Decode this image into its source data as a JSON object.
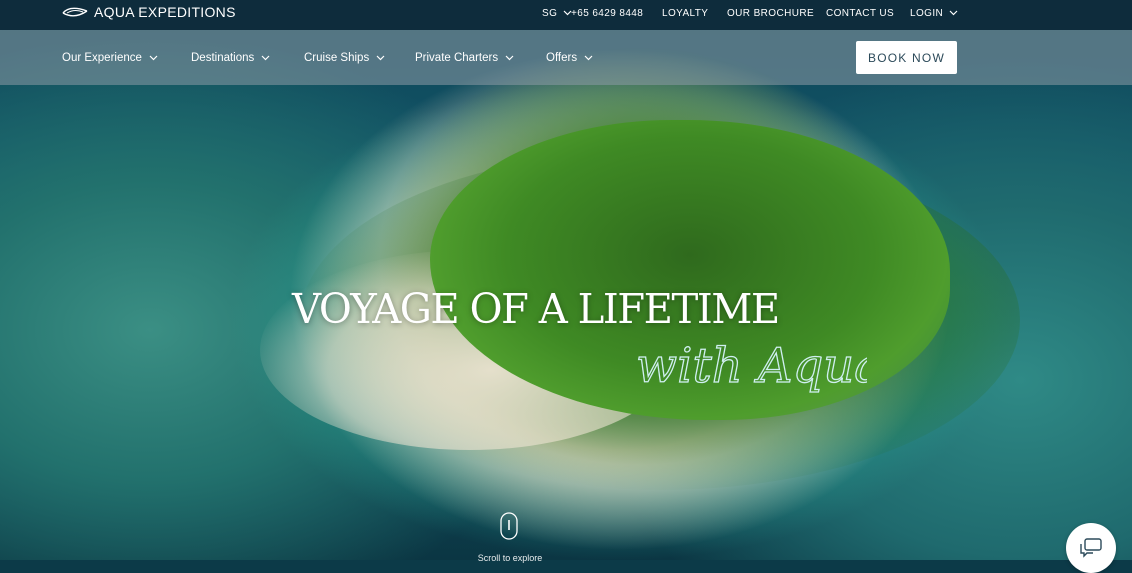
{
  "brand": {
    "name": "AQUA EXPEDITIONS",
    "logo_icon": "wave-logo-icon"
  },
  "utility_nav": {
    "region": "SG",
    "phone": "+65 6429 8448",
    "loyalty": "LOYALTY",
    "brochure": "OUR BROCHURE",
    "contact": "CONTACT US",
    "login": "LOGIN"
  },
  "main_nav": {
    "items": [
      {
        "label": "Our Experience"
      },
      {
        "label": "Destinations"
      },
      {
        "label": "Cruise Ships"
      },
      {
        "label": "Private Charters"
      },
      {
        "label": "Offers"
      }
    ],
    "book_label": "BOOK NOW"
  },
  "hero": {
    "headline": "VOYAGE OF A LIFETIME",
    "script_text": "with Aqua",
    "scroll_text": "Scroll to explore"
  },
  "icons": {
    "chevron": "chevron-down-icon",
    "scroll": "mouse-scroll-icon",
    "chat": "chat-bubble-icon"
  },
  "colors": {
    "topbar": "#0e2a3a",
    "button_text": "#2c4a5a",
    "sea": "#12566a",
    "lagoon": "#3fb6a8"
  }
}
